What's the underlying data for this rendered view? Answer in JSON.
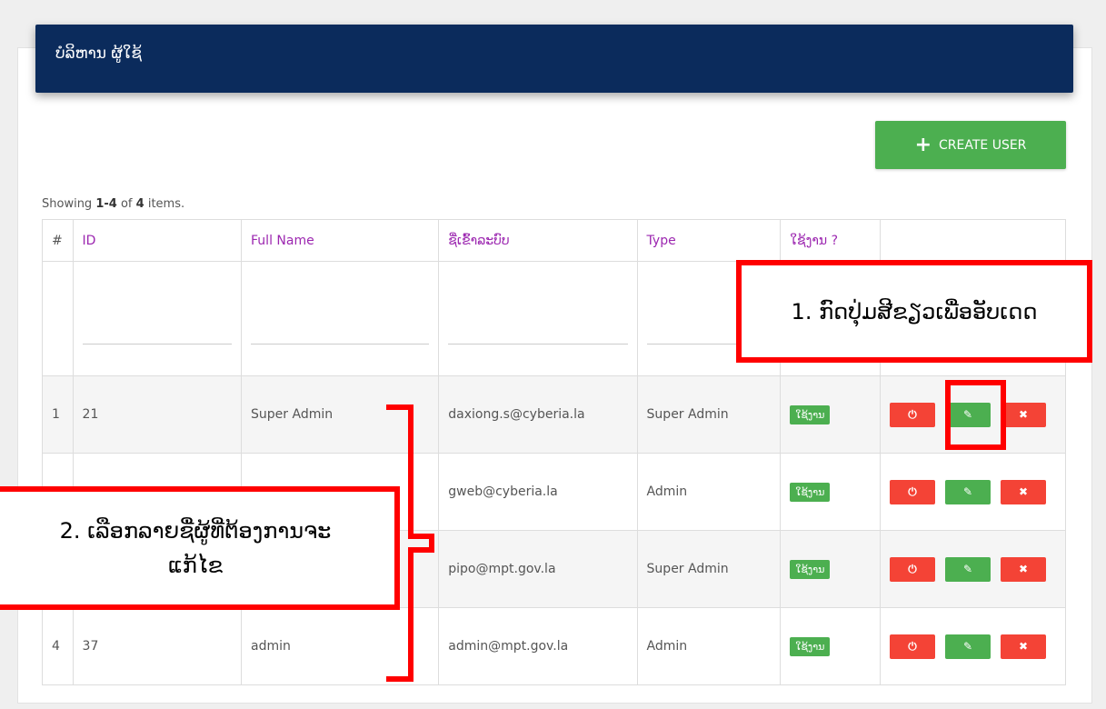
{
  "header": {
    "title": "ບໍລິຫານ ຜູ້ໃຊ້"
  },
  "toolbar": {
    "create_label": "CREATE USER"
  },
  "summary": {
    "prefix": "Showing",
    "range": "1-4",
    "of": "of",
    "total": "4",
    "suffix": "items."
  },
  "table": {
    "columns": [
      "#",
      "ID",
      "Full Name",
      "ຊື່ເຂົ້າລະບົບ",
      "Type",
      "ໃຊ້ງານ ?",
      ""
    ],
    "rows": [
      {
        "num": "1",
        "id": "21",
        "name": "Super Admin",
        "login": "daxiong.s@cyberia.la",
        "type": "Super Admin",
        "status": "ໃຊ້ງານ"
      },
      {
        "num": "",
        "id": "",
        "name": "",
        "login": "gweb@cyberia.la",
        "type": "Admin",
        "status": "ໃຊ້ງານ"
      },
      {
        "num": "",
        "id": "",
        "name": "",
        "login": "pipo@mpt.gov.la",
        "type": "Super Admin",
        "status": "ໃຊ້ງານ"
      },
      {
        "num": "4",
        "id": "37",
        "name": "admin",
        "login": "admin@mpt.gov.la",
        "type": "Admin",
        "status": "ໃຊ້ງານ"
      }
    ]
  },
  "icons": {
    "power": "⏻",
    "edit": "✎",
    "delete": "✖"
  },
  "annotations": {
    "step1": "1. ກົດປຸ່ມສີຂຽວເພື່ອອັບເດດ",
    "step2_line1": "2. ເລືອກລາຍຊື່ຜູ້ທີ່ຕ້ອງການຈະ",
    "step2_line2": "ແກ້ໄຂ"
  },
  "colors": {
    "header": "#0b2b5c",
    "accent": "#4caf50",
    "danger": "#f44336",
    "annotation": "#ff0000"
  }
}
